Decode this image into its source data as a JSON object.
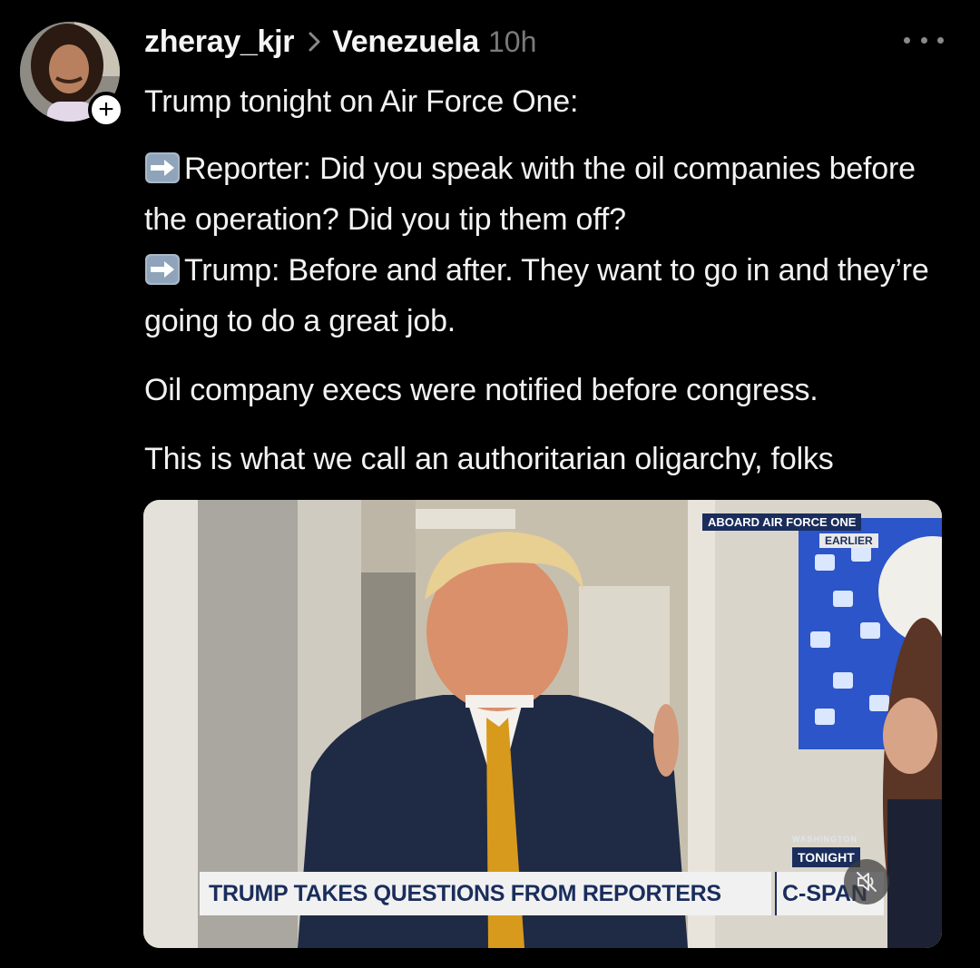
{
  "post": {
    "username": "zheray_kjr",
    "community": "Venezuela",
    "timestamp": "10h",
    "follow_symbol": "+",
    "paragraphs": {
      "intro": "Trump tonight on Air Force One:",
      "reporter": "Reporter: Did you speak with the oil companies before the operation? Did you tip them off?",
      "trump": "Trump: Before and after. They want to go in and they’re going to do a great job.",
      "notified": "Oil company execs were notified before congress.",
      "conclusion": "This is what we call an authoritarian oligarchy, folks"
    }
  },
  "media": {
    "overlays": {
      "aboard": "ABOARD AIR FORCE ONE",
      "earlier": "EARLIER",
      "washington": "WASHINGTON",
      "tonight": "TONIGHT",
      "chyron": "TRUMP TAKES QUESTIONS FROM REPORTERS",
      "network": "C-SPAN"
    },
    "muted": true
  },
  "icons": {
    "arrow": "right-arrow-emoji-icon",
    "chevron": "chevron-right-icon",
    "more": "more-dots-icon",
    "mute": "volume-muted-icon",
    "follow": "plus-icon"
  },
  "colors": {
    "background": "#000000",
    "text": "#f2f2f2",
    "muted_text": "#7a7a7a",
    "chyron_navy": "#1a2d5c"
  }
}
